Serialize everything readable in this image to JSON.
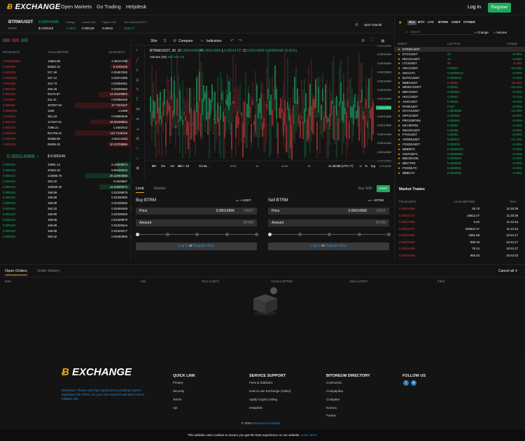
{
  "header": {
    "logo_prefix": "EX",
    "logo_rest": "CHANGE",
    "nav": [
      "Open Markets",
      "Go Trading",
      "Helpdesk"
    ],
    "login": "Log in",
    "register": "Register"
  },
  "ticker": {
    "pair": "BTRM/USDT",
    "sub": "BTRM",
    "price": "0.00014996",
    "price_sub": "$ 0.000149",
    "change_l": "Change",
    "change": "+1.00%",
    "low_l": "Lowest 24h",
    "low": "0.000139",
    "high_l": "Highest 24h",
    "high": "0.00015",
    "vol_l": "24h Volume(USDT)",
    "vol": "2535.27",
    "spot": "Spot Tutorial"
  },
  "orderbook": {
    "h_price": "Price(USDT)",
    "h_amount": "Amount(BTRM)",
    "h_total": "Sum(USDT)",
    "asks": [
      [
        "0.000159666",
        "14884.98",
        "2.38144795"
      ],
      [
        "0.000159",
        "59252.12",
        "9.4196445"
      ],
      [
        "0.000158",
        "217.48",
        "0.03457932"
      ],
      [
        "0.0001566",
        "207.12",
        "0.03272496"
      ],
      [
        "0.000156",
        "310.73",
        "0.03308461"
      ],
      [
        "0.000155",
        "205.26",
        "0.03200055"
      ],
      [
        "0.000153",
        "91176.97",
        "14.25449853"
      ],
      [
        "0.000152",
        "211.41",
        "0.03286425"
      ],
      [
        "0.000151",
        "307607.54",
        "47.7101627"
      ],
      [
        "0.0001506",
        "1000",
        "1.5499"
      ],
      [
        "0.000150",
        "351.33",
        "0.04880048"
      ],
      [
        "0.000149",
        "117267.51",
        "18.06199664"
      ],
      [
        "0.000149",
        "7296.21",
        "1.1932013"
      ],
      [
        "0.000149",
        "811765.41",
        "121.7148115"
      ],
      [
        "0.000149",
        "20485.85",
        "3.06212634"
      ],
      [
        "0.000149",
        "68265.33",
        "10.23708866"
      ]
    ],
    "mid_price": "0.00014996",
    "mid_usd": "$ 0.000149",
    "bids": [
      [
        "0.000146",
        "43691.14",
        "6.15029874"
      ],
      [
        "0.000145",
        "40454.46",
        "5.86185244"
      ],
      [
        "0.000144",
        "144696.75",
        "20.22660585"
      ],
      [
        "0.000140",
        "250.32",
        "0.0349587"
      ],
      [
        "0.000140",
        "100250.32",
        "14.03509472"
      ],
      [
        "0.000140",
        "168.89",
        "0.02339879"
      ],
      [
        "0.000140",
        "168.89",
        "0.02330080"
      ],
      [
        "0.000140",
        "168.89",
        "0.02330540"
      ],
      [
        "0.000140",
        "250.32",
        "0.03495468"
      ],
      [
        "0.000140",
        "168.89",
        "0.02330645"
      ],
      [
        "0.000140",
        "168.89",
        "0.02329878"
      ],
      [
        "0.000140",
        "168.89",
        "0.02329644"
      ],
      [
        "0.000140",
        "168.89",
        "0.02329477"
      ],
      [
        "0.000140",
        "250.32",
        "0.03493966"
      ]
    ]
  },
  "chart": {
    "interval": "30m",
    "compare": "Compare",
    "indicators": "Indicators",
    "symbol": "BTRM/USDT, 30",
    "o": "0.00014996",
    "h": "0.00014996",
    "l": "0.00014727",
    "c": "0.00014996",
    "chg": "0.00000000 (0.00%)",
    "volume": "Volume (20)",
    "vol_val": "462.975",
    "vol_na": "n/a",
    "yticks": [
      "0.00016400",
      "0.00016200",
      "0.00016000",
      "0.00015800",
      "0.00015600",
      "0.00015400",
      "0.00015200",
      "0.00015000",
      "0.00014800",
      "0.00014600",
      "0.00014400",
      "0.00014200",
      "0.00014000",
      "0.00013800"
    ],
    "last": "0.00014996",
    "xticks": [
      "12",
      "12:00",
      "13",
      "12:00",
      "14",
      "12:00",
      "15",
      "12:00",
      "16",
      "12:00"
    ],
    "ranges": [
      "6m",
      "3m",
      "1m",
      "5d",
      "1d",
      "Go to..."
    ],
    "time": "11:21:33 (UTC+7)",
    "pct": "%",
    "log": "log",
    "auto": "auto"
  },
  "trade": {
    "tabs": [
      "Limit",
      "Market"
    ],
    "buy_with": "Buy With",
    "buy_with_val": "USDT",
    "buy_title": "Buy BTRM",
    "sell_title": "Sell BTRM",
    "buy_bal": "~ USDT",
    "sell_bal": "~ BTRM",
    "price_l": "Price",
    "amount_l": "Amount",
    "buy_price": "0.00014996",
    "sell_price": "0.00014996",
    "usd": "USDT",
    "btrm": "BTRM",
    "login": "Log in",
    "or": "or",
    "reg": "Register Now"
  },
  "markets": {
    "tabs": [
      "ALL",
      "BTC",
      "LTC",
      "BTRM",
      "USDT",
      "OTHER"
    ],
    "search": "Search",
    "mode_change": "Change",
    "mode_volume": "Volume",
    "h_market": "Market",
    "h_last": "Last Price",
    "h_change": "Change",
    "rows": [
      [
        "BTRM/USDT",
        "",
        "",
        "w"
      ],
      [
        "ETC/USDT",
        "20",
        "+0.00%",
        "g"
      ],
      [
        "RECK/USDT",
        "14",
        "+4.60%",
        "g"
      ],
      [
        "LTC/USDT",
        "95",
        "-9.18%",
        "r"
      ],
      [
        "GEC/USDT",
        "0.00024",
        "+13.33%",
        "g"
      ],
      [
        "GEC/LTC",
        "0.00000012",
        "+0.00%",
        "g"
      ],
      [
        "BUTK/USDT",
        "0.0000016",
        "+0.00%",
        "g"
      ],
      [
        "BBB/USDT",
        "0.00081",
        "-16.49%",
        "r"
      ],
      [
        "MEWC/USDT",
        "0.00031",
        "+31.42%",
        "g"
      ],
      [
        "BBC/USDT",
        "0.000054",
        "+0.00%",
        "g"
      ],
      [
        "HUC/USDT",
        "0.00001",
        "+5.11%",
        "g"
      ],
      [
        "AVN/USDT",
        "0.00020",
        "+0.03%",
        "g"
      ],
      [
        "RVN/USDT",
        "0.027",
        "+0.00%",
        "g"
      ],
      [
        "OCTA/USDT",
        "0.0000988",
        "+44.33%",
        "g"
      ],
      [
        "ISPC/USDT",
        "0.000062",
        "+0.00%",
        "g"
      ],
      [
        "PRCO/BTRM",
        "0.000004",
        "+0.00%",
        "g"
      ],
      [
        "KEY/BTRM",
        "0.00002",
        "+0.00%",
        "g"
      ],
      [
        "NEOX/USDT",
        "0.00465",
        "+0.00%",
        "g"
      ],
      [
        "PTA/USDT",
        "0.00004",
        "+0.00%",
        "g"
      ],
      [
        "YERB/USDT",
        "0.000037",
        "+41.13%",
        "g"
      ],
      [
        "FOXD/USDT",
        "0.000004",
        "+0.00%",
        "g"
      ],
      [
        "BBB/BTC",
        "0.00000010",
        "+0.00%",
        "g"
      ],
      [
        "GSPC/BTC",
        "0.00000001",
        "+0.00%",
        "g"
      ],
      [
        "BBC/DOGE",
        "0.0000010",
        "+0.00%",
        "g"
      ],
      [
        "BBC/TRX",
        "0.0000002",
        "+0.00%",
        "g"
      ],
      [
        "FOXD/LTC",
        "0.0000002",
        "+0.00%",
        "g"
      ],
      [
        "BBB/LTC",
        "0.0000002",
        "+0.00%",
        "g"
      ]
    ]
  },
  "mtrades": {
    "title": "Market Trades",
    "h_price": "Price(USDT)",
    "h_amount": "Amount(BTRM)",
    "h_time": "Time",
    "rows": [
      [
        "0.00014996",
        "25.78",
        "11:20:39",
        "r"
      ],
      [
        "0.00014727",
        "16812.47",
        "11:20:39",
        "r"
      ],
      [
        "0.00014886",
        "9.32",
        "11:12:16",
        "r"
      ],
      [
        "0.00014727",
        "245822.47",
        "11:12:16",
        "r"
      ],
      [
        "0.00014846",
        "2361.68",
        "10:44:17",
        "r"
      ],
      [
        "0.00014849",
        "959.33",
        "10:44:17",
        "r"
      ],
      [
        "0.00014849",
        "78.14",
        "10:44:17",
        "r"
      ],
      [
        "0.00014838",
        "959.33",
        "10:43:33",
        "r"
      ]
    ]
  },
  "orders": {
    "tabs": [
      "Open Orders",
      "Order History"
    ],
    "cancel": "Cancel all",
    "cols": [
      "Date",
      "Pair",
      "Price (USDT)",
      "Amount (BTRM)",
      "Value (USDT)",
      "Filled"
    ]
  },
  "footer": {
    "desc": "Disclaimer: Please note that cryptocurrency trading involves significant risk of loss. Do your own research and learn how to mitigate risk.",
    "quick": {
      "title": "QUICK LINK",
      "items": [
        "Privacy",
        "Security",
        "Terms",
        "Api"
      ]
    },
    "service": {
      "title": "SERVICE SUPPORT",
      "items": [
        "Fees & Statistics",
        "How to use Exchange (Video)",
        "Apply Crypto Listing",
        "Helpdesk"
      ]
    },
    "directory": {
      "title": "BITOREUM DIRECTORY",
      "items": [
        "CoinGecko",
        "Coinpaprika",
        "Coinpaire",
        "Nomics",
        "Forbes"
      ]
    },
    "follow": "FOLLOW US",
    "copyright": "© 2022",
    "copy_link": "Bitoreum Exchange",
    "cookie": "This website uses cookies to ensure you get the best experience on our website.",
    "learn": "Learn More"
  },
  "colors": {
    "green": "#1bb56a",
    "red": "#d13d3d",
    "gold": "#e2a51c",
    "accent": "#2c8cd6"
  }
}
